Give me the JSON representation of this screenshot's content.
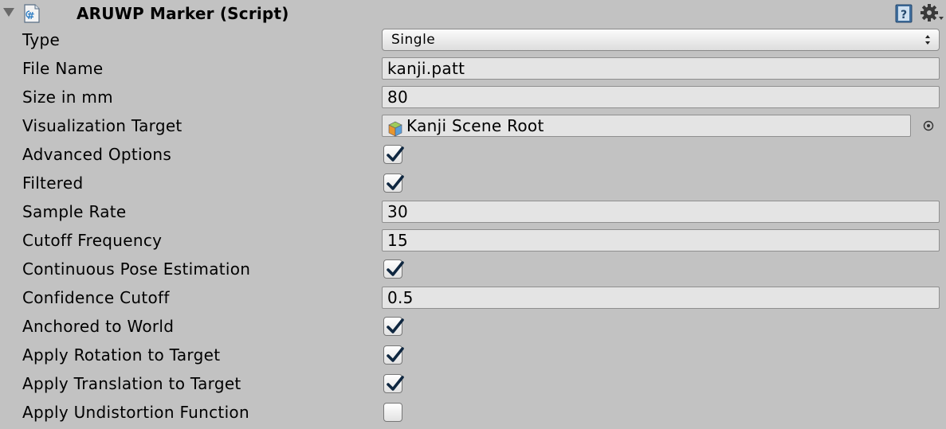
{
  "component": {
    "title": "ARUWP Marker (Script)",
    "icons": [
      "foldout-arrow-icon",
      "csharp-script-icon",
      "help-book-icon",
      "gear-icon"
    ]
  },
  "fields": {
    "type": {
      "label": "Type",
      "value": "Single"
    },
    "file_name": {
      "label": "File Name",
      "value": "kanji.patt"
    },
    "size_in_mm": {
      "label": "Size in mm",
      "value": "80"
    },
    "visualization_target": {
      "label": "Visualization Target",
      "value": "Kanji Scene Root",
      "icon": "gameobject-cube-icon"
    },
    "advanced_options": {
      "label": "Advanced Options",
      "checked": true
    },
    "filtered": {
      "label": "Filtered",
      "checked": true
    },
    "sample_rate": {
      "label": "Sample Rate",
      "value": "30"
    },
    "cutoff_frequency": {
      "label": "Cutoff Frequency",
      "value": "15"
    },
    "continuous_pose_estimation": {
      "label": "Continuous Pose Estimation",
      "checked": true
    },
    "confidence_cutoff": {
      "label": "Confidence Cutoff",
      "value": "0.5"
    },
    "anchored_to_world": {
      "label": "Anchored to World",
      "checked": true
    },
    "apply_rotation_to_target": {
      "label": "Apply Rotation to Target",
      "checked": true
    },
    "apply_translation_to_target": {
      "label": "Apply Translation to Target",
      "checked": true
    },
    "apply_undistortion_function": {
      "label": "Apply Undistortion Function",
      "checked": false
    }
  },
  "colors": {
    "panel_background": "#c2c2c2",
    "field_background": "#e4e4e4",
    "check_mark": "#0f2740"
  }
}
